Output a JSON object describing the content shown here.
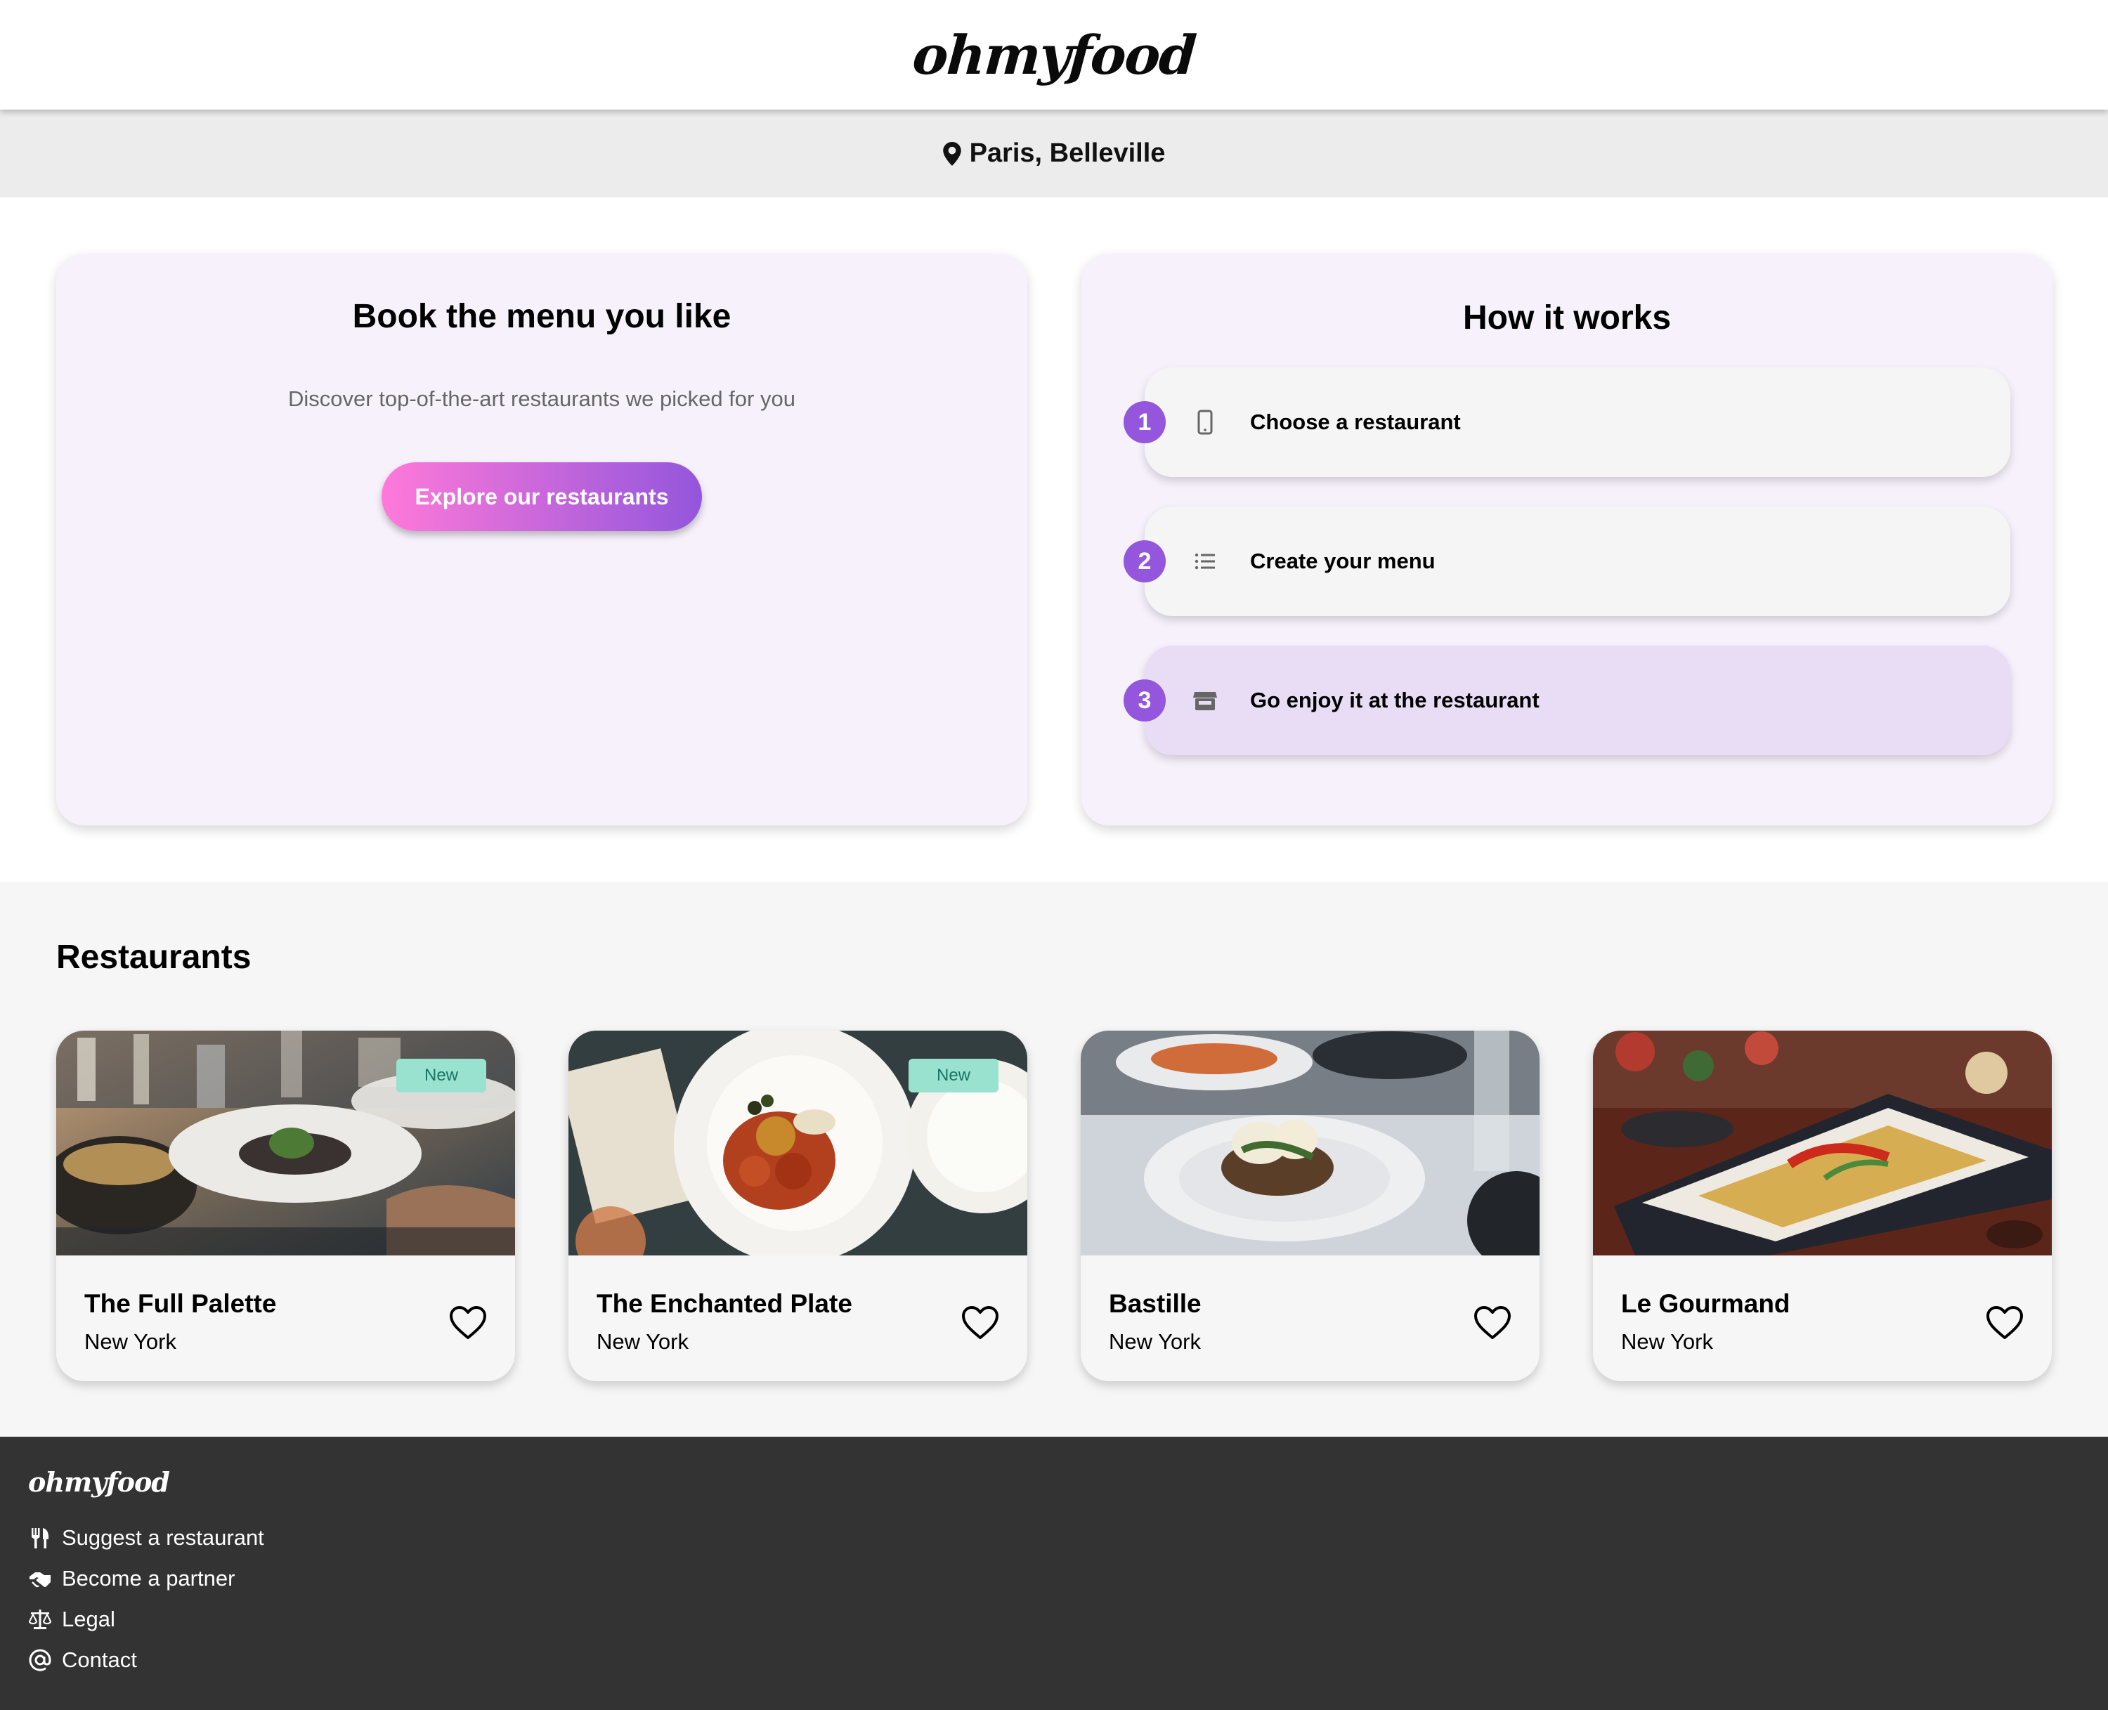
{
  "header": {
    "logo": "ohmyfood"
  },
  "location": {
    "text": "Paris, Belleville",
    "icon": "map-pin-icon"
  },
  "hero": {
    "title": "Book the menu you like",
    "subtitle": "Discover top-of-the-art restaurants we picked for you",
    "cta_label": "Explore our restaurants",
    "cta_gradient": [
      "#ff79da",
      "#9356dc"
    ]
  },
  "how_it_works": {
    "title": "How it works",
    "steps": [
      {
        "number": "1",
        "label": "Choose a restaurant",
        "icon": "mobile-phone-icon"
      },
      {
        "number": "2",
        "label": "Create your menu",
        "icon": "list-icon"
      },
      {
        "number": "3",
        "label": "Go enjoy it at the restaurant",
        "icon": "store-icon"
      }
    ],
    "accent": "#9356dc"
  },
  "restaurants": {
    "title": "Restaurants",
    "items": [
      {
        "name": "The Full Palette",
        "city": "New York",
        "badge": "New"
      },
      {
        "name": "The Enchanted Plate",
        "city": "New York",
        "badge": "New"
      },
      {
        "name": "Bastille",
        "city": "New York"
      },
      {
        "name": "Le Gourmand",
        "city": "New York"
      }
    ]
  },
  "footer": {
    "logo": "ohmyfood",
    "links": [
      {
        "label": "Suggest a restaurant",
        "icon": "utensils-icon"
      },
      {
        "label": "Become a partner",
        "icon": "handshake-icon"
      },
      {
        "label": "Legal",
        "icon": "scale-icon"
      },
      {
        "label": "Contact",
        "icon": "at-sign-icon"
      }
    ],
    "background": "#333333"
  }
}
